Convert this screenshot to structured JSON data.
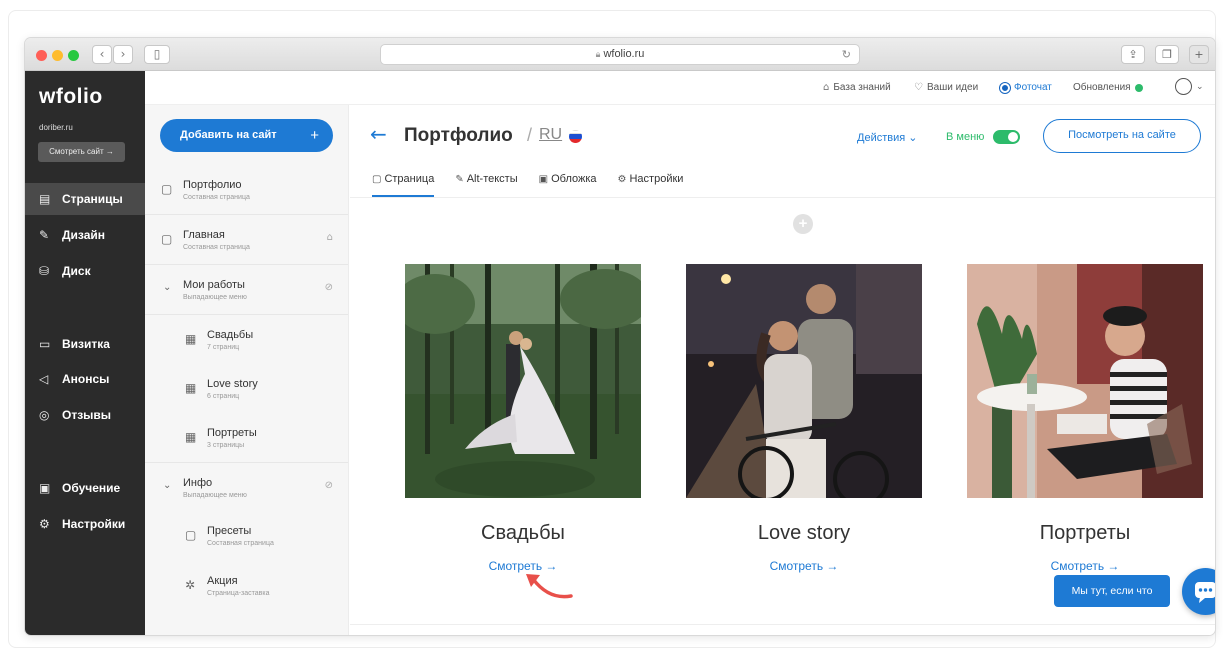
{
  "browser": {
    "url": "wfolio.ru",
    "back_icon": "chevron-left-icon",
    "forward_icon": "chevron-right-icon"
  },
  "sidebar": {
    "logo": "wfolio",
    "domain": "doriber.ru",
    "view_site_label": "Смотреть сайт →",
    "items": [
      {
        "label": "Страницы",
        "icon": "page-icon",
        "active": true
      },
      {
        "label": "Дизайн",
        "icon": "brush-icon"
      },
      {
        "label": "Диск",
        "icon": "database-icon"
      },
      {
        "label": "Визитка",
        "icon": "card-icon"
      },
      {
        "label": "Анонсы",
        "icon": "megaphone-icon"
      },
      {
        "label": "Отзывы",
        "icon": "chat-icon"
      },
      {
        "label": "Обучение",
        "icon": "book-icon"
      },
      {
        "label": "Настройки",
        "icon": "gear-icon"
      }
    ]
  },
  "topbar": {
    "knowledge": "База знаний",
    "ideas": "Ваши идеи",
    "photochat": "Фоточат",
    "updates": "Обновления"
  },
  "pages": {
    "add_label": "Добавить на сайт",
    "items": [
      {
        "title": "Портфолио",
        "sub": "Составная страница"
      },
      {
        "title": "Главная",
        "sub": "Составная страница"
      },
      {
        "title": "Мои работы",
        "sub": "Выпадающее меню"
      },
      {
        "title": "Свадьбы",
        "sub": "7 страниц"
      },
      {
        "title": "Love story",
        "sub": "6 страниц"
      },
      {
        "title": "Портреты",
        "sub": "3 страницы"
      },
      {
        "title": "Инфо",
        "sub": "Выпадающее меню"
      },
      {
        "title": "Пресеты",
        "sub": "Составная страница"
      },
      {
        "title": "Акция",
        "sub": "Страница-заставка"
      }
    ]
  },
  "main": {
    "title": "Портфолио",
    "separator": "/",
    "lang": "RU",
    "actions": "Действия ⌄",
    "in_menu": "В меню",
    "in_menu_on": true,
    "view_on_site": "Посмотреть на сайте",
    "tabs": [
      {
        "label": "Страница",
        "icon": "page-icon",
        "active": true
      },
      {
        "label": "Alt-тексты",
        "icon": "edit-icon"
      },
      {
        "label": "Обложка",
        "icon": "image-icon"
      },
      {
        "label": "Настройки",
        "icon": "gear-icon"
      }
    ],
    "cards": [
      {
        "title": "Свадьбы",
        "link": "Смотреть →"
      },
      {
        "title": "Love story",
        "link": "Смотреть →"
      },
      {
        "title": "Портреты",
        "link": "Смотреть →"
      }
    ]
  },
  "help": {
    "label": "Мы тут, если что"
  },
  "colors": {
    "accent": "#1e7ad4",
    "sidebar": "#2b2b2b",
    "green": "#2dbb6b",
    "annotation": "#e8504a"
  }
}
